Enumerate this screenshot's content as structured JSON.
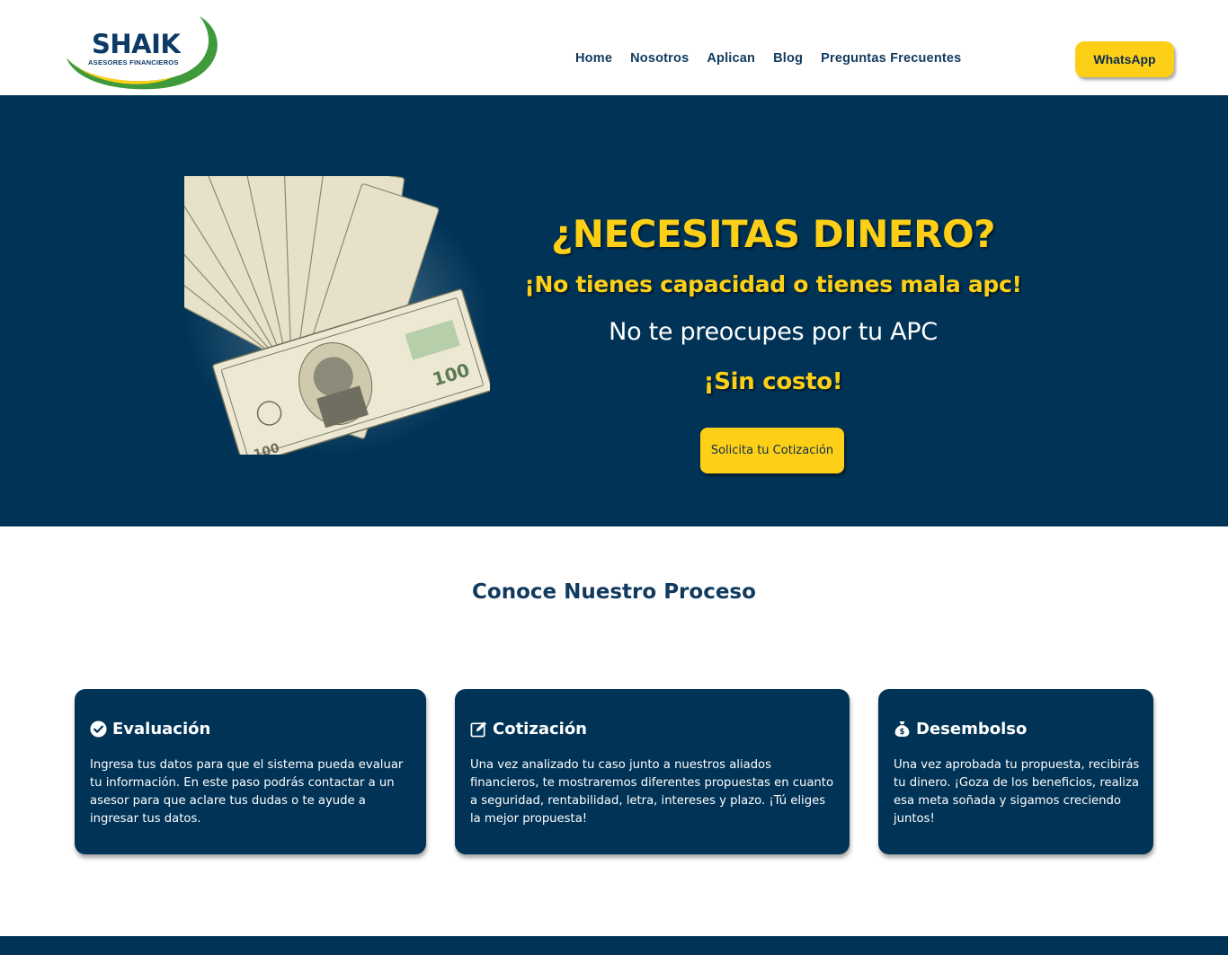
{
  "brand": {
    "name": "SHAIK",
    "tagline": "ASESORES FINANCIEROS",
    "colors": {
      "navy": "#003356",
      "yellow": "#fdd017",
      "green": "#3f9a3b"
    }
  },
  "nav": {
    "items": [
      {
        "label": "Home"
      },
      {
        "label": "Nosotros"
      },
      {
        "label": "Aplican"
      },
      {
        "label": "Blog"
      },
      {
        "label": "Preguntas Frecuentes"
      }
    ],
    "whatsapp_label": "WhatsApp"
  },
  "hero": {
    "title": "¿NECESITAS DINERO?",
    "subtitle": "¡No tienes capacidad o tienes mala apc!",
    "text": "No te preocupes por tu APC",
    "highlight": "¡Sin costo!",
    "cta_label": "Solicita tu Cotización",
    "image_icon": "hundred-dollar-bills-fan"
  },
  "process": {
    "title": "Conoce Nuestro Proceso",
    "cards": [
      {
        "icon": "check-circle-icon",
        "title": "Evaluación",
        "body": "Ingresa tus datos para que el sistema pueda evaluar tu información. En este paso podrás contactar a un asesor para que aclare tus dudas o te ayude a ingresar tus datos."
      },
      {
        "icon": "edit-icon",
        "title": "Cotización",
        "body": "Una vez analizado tu caso junto a nuestros aliados financieros, te mostraremos diferentes propuestas en cuanto a seguridad, rentabilidad, letra, intereses y plazo. ¡Tú eliges la mejor propuesta!"
      },
      {
        "icon": "money-bag-icon",
        "title": "Desembolso",
        "body": "Una vez aprobada tu propuesta, recibirás tu dinero. ¡Goza de los beneficios, realiza esa meta soñada y sigamos creciendo juntos!"
      }
    ]
  }
}
